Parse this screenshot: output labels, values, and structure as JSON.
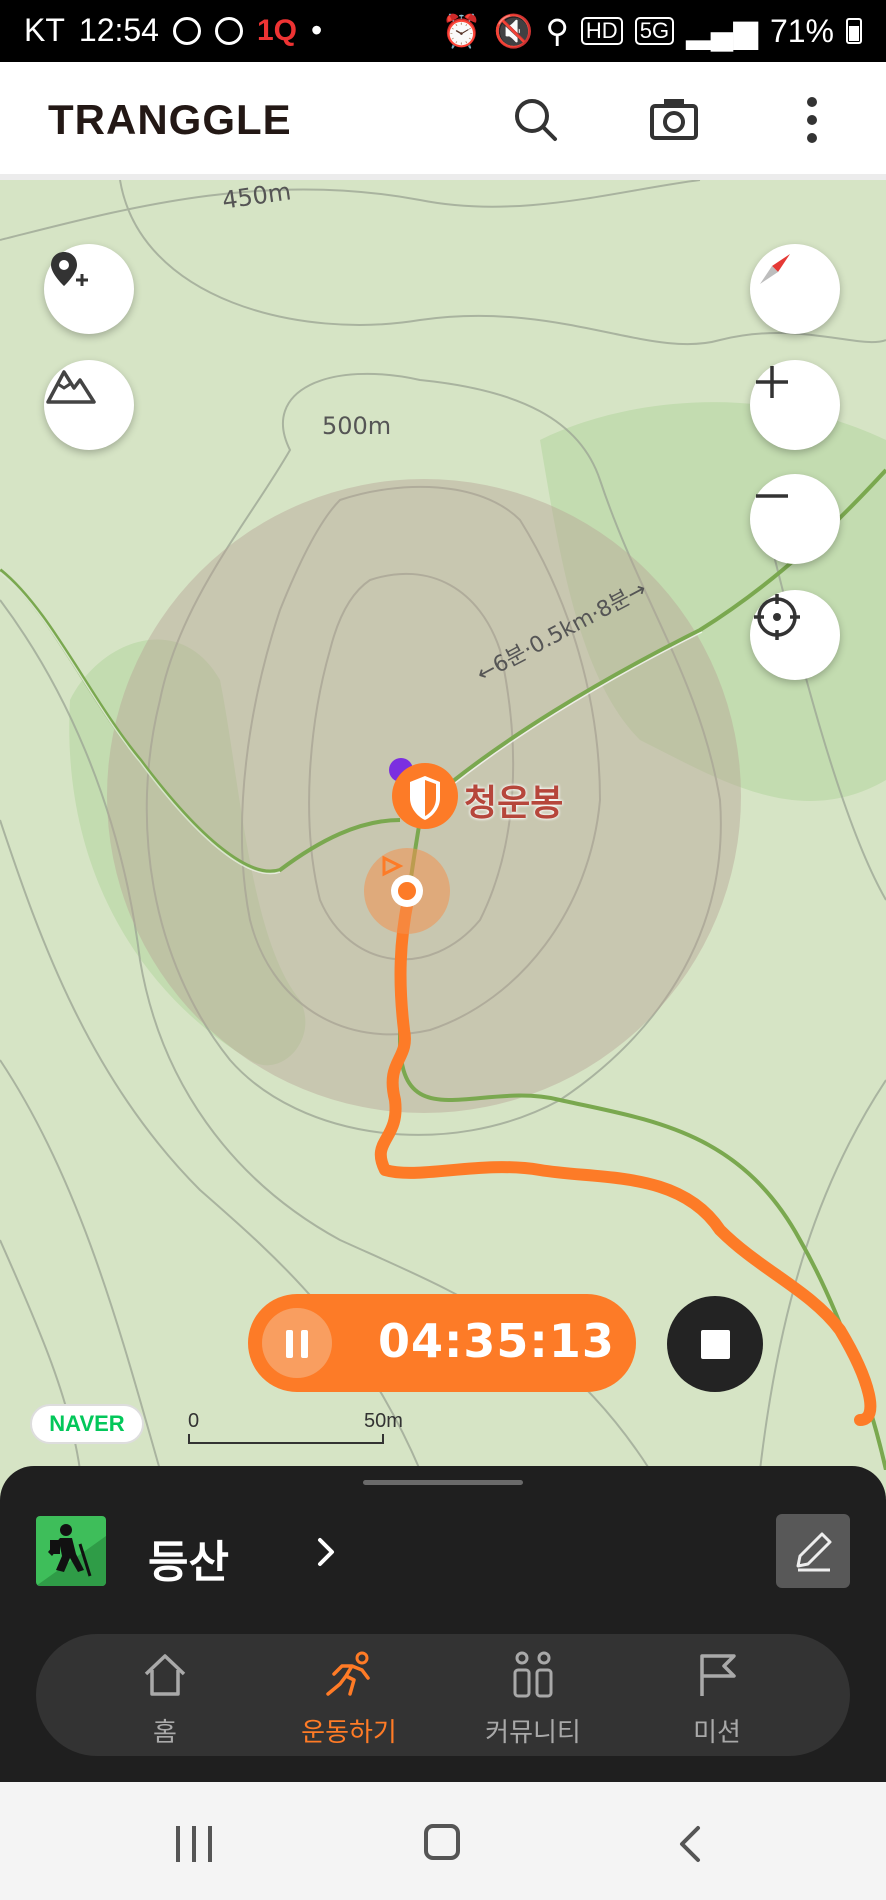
{
  "status_bar": {
    "carrier": "KT",
    "time": "12:54",
    "indicator_1q": "1Q",
    "network": "5G",
    "hd": "HD",
    "battery": "71%"
  },
  "app_bar": {
    "logo": "TRANGGLE",
    "icons": [
      "search-icon",
      "camera-icon",
      "more-vert-icon"
    ]
  },
  "map": {
    "contour_labels": [
      "450m",
      "500m"
    ],
    "trail_label": "←6분·0.5km·8분→",
    "peak_name": "청운봉",
    "left_buttons": [
      "add-location-icon",
      "mountain-icon"
    ],
    "right_buttons": [
      "compass-icon",
      "zoom-in-icon",
      "zoom-out-icon",
      "my-location-icon"
    ],
    "provider": "NAVER",
    "scale": {
      "start": "0",
      "end": "50m"
    },
    "colors": {
      "route": "#fd7b27",
      "trail": "#7aa84f",
      "radius": "#c9b9ad"
    }
  },
  "recording": {
    "elapsed": "04:35:13"
  },
  "activity": {
    "label": "등산",
    "icon": "hiking-icon"
  },
  "bottom_nav": {
    "items": [
      {
        "label": "홈",
        "icon": "home-icon",
        "active": false
      },
      {
        "label": "운동하기",
        "icon": "running-icon",
        "active": true
      },
      {
        "label": "커뮤니티",
        "icon": "community-icon",
        "active": false
      },
      {
        "label": "미션",
        "icon": "flag-icon",
        "active": false
      }
    ]
  }
}
